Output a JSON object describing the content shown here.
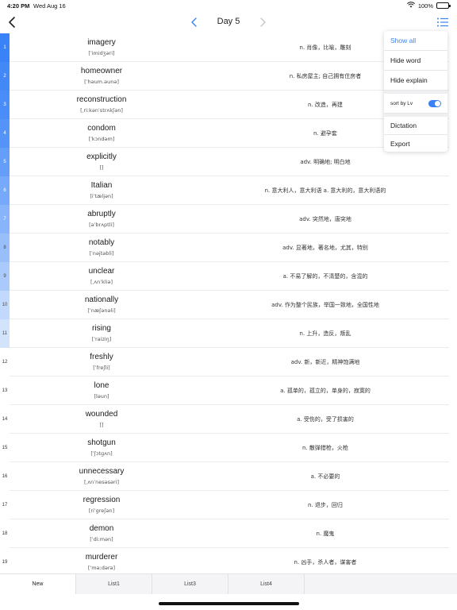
{
  "status_bar": {
    "time": "4:20 PM",
    "date": "Wed Aug 16",
    "battery": "100%"
  },
  "nav": {
    "title": "Day 5"
  },
  "colors": {
    "accent": "#3a82f7",
    "disabled": "#c4c4c8"
  },
  "words": [
    {
      "index": "1",
      "word": "imagery",
      "phonetic": "[ˈimidʒəri]",
      "explain": "n. 肖像，比喻，雕刻",
      "level": 1.0
    },
    {
      "index": "2",
      "word": "homeowner",
      "phonetic": "[ˈhəum.əunə]",
      "explain": "n. 私房屋主; 自己拥有住房者",
      "level": 0.95
    },
    {
      "index": "3",
      "word": "reconstruction",
      "phonetic": "[ˌriːkənˈstrʌkʃən]",
      "explain": "n. 改造，再建",
      "level": 0.9
    },
    {
      "index": "4",
      "word": "condom",
      "phonetic": "[ˈkɔndəm]",
      "explain": "n. 避孕套",
      "level": 0.85
    },
    {
      "index": "5",
      "word": "explicitly",
      "phonetic": "[]",
      "explain": "adv. 明确地; 明白地",
      "level": 0.75
    },
    {
      "index": "6",
      "word": "Italian",
      "phonetic": "[iˈtæljən]",
      "explain": "n. 意大利人，意大利语 a. 意大利的，意大利语的",
      "level": 0.65
    },
    {
      "index": "7",
      "word": "abruptly",
      "phonetic": "[əˈbrʌptli]",
      "explain": "adv. 突然地，唐突地",
      "level": 0.55
    },
    {
      "index": "8",
      "word": "notably",
      "phonetic": "[ˈnəjtəbli]",
      "explain": "adv. 显著地，著名地，尤其，特别",
      "level": 0.45
    },
    {
      "index": "9",
      "word": "unclear",
      "phonetic": "[ˌʌnˈkliə]",
      "explain": "a. 不易了解的，不清楚的，含混的",
      "level": 0.35
    },
    {
      "index": "10",
      "word": "nationally",
      "phonetic": "[ˈnæʃənəli]",
      "explain": "adv. 作为整个民族，举国一致地，全国性地",
      "level": 0.22
    },
    {
      "index": "11",
      "word": "rising",
      "phonetic": "[ˈraiziŋ]",
      "explain": "n. 上升，造反，叛乱",
      "level": 0.12
    },
    {
      "index": "12",
      "word": "freshly",
      "phonetic": "[ˈfreʃli]",
      "explain": "adv. 新，新近，精神饱满地",
      "level": 0
    },
    {
      "index": "13",
      "word": "lone",
      "phonetic": "[ləun]",
      "explain": "a. 孤单的，孤立的，单身的，寂寞的",
      "level": 0
    },
    {
      "index": "14",
      "word": "wounded",
      "phonetic": "[]",
      "explain": "a. 受伤的，受了损害的",
      "level": 0
    },
    {
      "index": "15",
      "word": "shotgun",
      "phonetic": "[ˈʃɔtgʌn]",
      "explain": "n. 散弹猎枪，火枪",
      "level": 0
    },
    {
      "index": "16",
      "word": "unnecessary",
      "phonetic": "[ˌʌnˈnesəsəri]",
      "explain": "a. 不必要的",
      "level": 0
    },
    {
      "index": "17",
      "word": "regression",
      "phonetic": "[riˈgreʃən]",
      "explain": "n. 退步，回归",
      "level": 0
    },
    {
      "index": "18",
      "word": "demon",
      "phonetic": "[ˈdiːmən]",
      "explain": "n. 魔鬼",
      "level": 0
    },
    {
      "index": "19",
      "word": "murderer",
      "phonetic": "[ˈməːdərə]",
      "explain": "n. 凶手，杀人者，谋害者",
      "level": 0
    }
  ],
  "menu": {
    "show_all": "Show all",
    "hide_word": "Hide word",
    "hide_explain": "Hide explain",
    "sort_by_lv": "sort by Lv",
    "sort_by_lv_on": true,
    "dictation": "Dictation",
    "export": "Export"
  },
  "tabs": [
    "New",
    "List1",
    "List3",
    "List4"
  ],
  "selected_tab": "New"
}
